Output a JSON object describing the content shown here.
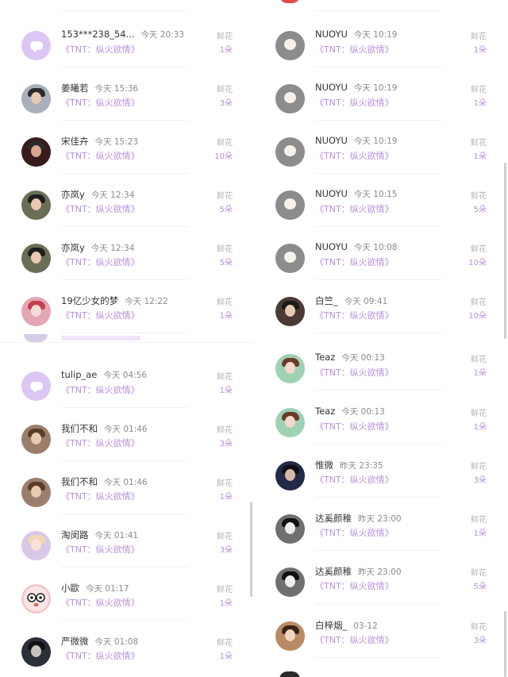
{
  "left": {
    "rows": [
      {
        "name": "153***238_54...",
        "time": "今天 20:33",
        "song": "《TNT：纵火欲情》",
        "label": "鲜花",
        "count": "1朵",
        "avatar": "chat-bubble",
        "bg": "#dcc7f4"
      },
      {
        "name": "姜曦若",
        "time": "今天 15:36",
        "song": "《TNT：纵火欲情》",
        "label": "鲜花",
        "count": "3朵",
        "avatar": "portrait",
        "bg": "#a9b0bb"
      },
      {
        "name": "宋佳卉",
        "time": "今天 15:23",
        "song": "《TNT：纵火欲情》",
        "label": "鲜花",
        "count": "10朵",
        "avatar": "portrait",
        "bg": "#3a1b1b"
      },
      {
        "name": "亦岚y",
        "time": "今天 12:34",
        "song": "《TNT：纵火欲情》",
        "label": "鲜花",
        "count": "5朵",
        "avatar": "portrait",
        "bg": "#6a6e57"
      },
      {
        "name": "亦岚y",
        "time": "今天 12:34",
        "song": "《TNT：纵火欲情》",
        "label": "鲜花",
        "count": "5朵",
        "avatar": "portrait",
        "bg": "#6a6e57"
      },
      {
        "name": "19亿少女的梦",
        "time": "今天 12:22",
        "song": "《TNT：纵火欲情》",
        "label": "鲜花",
        "count": "1朵",
        "avatar": "portrait",
        "bg": "#e4a6b4"
      },
      {
        "name": "tulip_ae",
        "time": "今天 04:56",
        "song": "《TNT：纵火欲情》",
        "label": "鲜花",
        "count": "1朵",
        "avatar": "chat-bubble",
        "bg": "#dcc7f4"
      },
      {
        "name": "我们不和",
        "time": "今天 01:46",
        "song": "《TNT：纵火欲情》",
        "label": "鲜花",
        "count": "3朵",
        "avatar": "portrait",
        "bg": "#9c7e6d"
      },
      {
        "name": "我们不和",
        "time": "今天 01:46",
        "song": "《TNT：纵火欲情》",
        "label": "鲜花",
        "count": "1朵",
        "avatar": "portrait",
        "bg": "#9c7e6d"
      },
      {
        "name": "淘闵路",
        "time": "今天 01:41",
        "song": "《TNT：纵火欲情》",
        "label": "鲜花",
        "count": "3朵",
        "avatar": "portrait",
        "bg": "#d9c7e8"
      },
      {
        "name": "小歐",
        "time": "今天 01:17",
        "song": "《TNT：纵火欲情》",
        "label": "鲜花",
        "count": "1朵",
        "avatar": "cartoon",
        "bg": "#f3c6c6"
      },
      {
        "name": "严微微",
        "time": "今天 01:08",
        "song": "《TNT：纵火欲情》",
        "label": "鲜花",
        "count": "1朵",
        "avatar": "portrait",
        "bg": "#2a2f3a"
      }
    ]
  },
  "right": {
    "rows": [
      {
        "name": "NUOYU",
        "time": "今天 10:19",
        "song": "《TNT：纵火欲情》",
        "label": "鲜花",
        "count": "1朵",
        "avatar": "dog",
        "bg": "#8c8c8c"
      },
      {
        "name": "NUOYU",
        "time": "今天 10:19",
        "song": "《TNT：纵火欲情》",
        "label": "鲜花",
        "count": "1朵",
        "avatar": "dog",
        "bg": "#8c8c8c"
      },
      {
        "name": "NUOYU",
        "time": "今天 10:19",
        "song": "《TNT：纵火欲情》",
        "label": "鲜花",
        "count": "1朵",
        "avatar": "dog",
        "bg": "#8c8c8c"
      },
      {
        "name": "NUOYU",
        "time": "今天 10:15",
        "song": "《TNT：纵火欲情》",
        "label": "鲜花",
        "count": "5朵",
        "avatar": "dog",
        "bg": "#8c8c8c"
      },
      {
        "name": "NUOYU",
        "time": "今天 10:08",
        "song": "《TNT：纵火欲情》",
        "label": "鲜花",
        "count": "10朵",
        "avatar": "dog",
        "bg": "#8c8c8c"
      },
      {
        "name": "白竺_",
        "time": "今天 09:41",
        "song": "《TNT：纵火欲情》",
        "label": "鲜花",
        "count": "10朵",
        "avatar": "portrait",
        "bg": "#4b3a35"
      },
      {
        "name": "Teaz",
        "time": "今天 00:13",
        "song": "《TNT：纵火欲情》",
        "label": "鲜花",
        "count": "1朵",
        "avatar": "portrait",
        "bg": "#9fd1b5"
      },
      {
        "name": "Teaz",
        "time": "今天 00:13",
        "song": "《TNT：纵火欲情》",
        "label": "鲜花",
        "count": "1朵",
        "avatar": "portrait",
        "bg": "#9fd1b5"
      },
      {
        "name": "惟微",
        "time": "昨天 23:35",
        "song": "《TNT：纵火欲情》",
        "label": "鲜花",
        "count": "3朵",
        "avatar": "portrait",
        "bg": "#232a47"
      },
      {
        "name": "达奚颜稚",
        "time": "昨天 23:00",
        "song": "《TNT：纵火欲情》",
        "label": "鲜花",
        "count": "1朵",
        "avatar": "portrait",
        "bg": "#6f6f6f"
      },
      {
        "name": "达奚颜稚",
        "time": "昨天 23:00",
        "song": "《TNT：纵火欲情》",
        "label": "鲜花",
        "count": "5朵",
        "avatar": "portrait",
        "bg": "#6f6f6f"
      },
      {
        "name": "白梓烟_",
        "time": "03-12",
        "song": "《TNT：纵火欲情》",
        "label": "鲜花",
        "count": "3朵",
        "avatar": "portrait",
        "bg": "#b98b64"
      }
    ]
  }
}
